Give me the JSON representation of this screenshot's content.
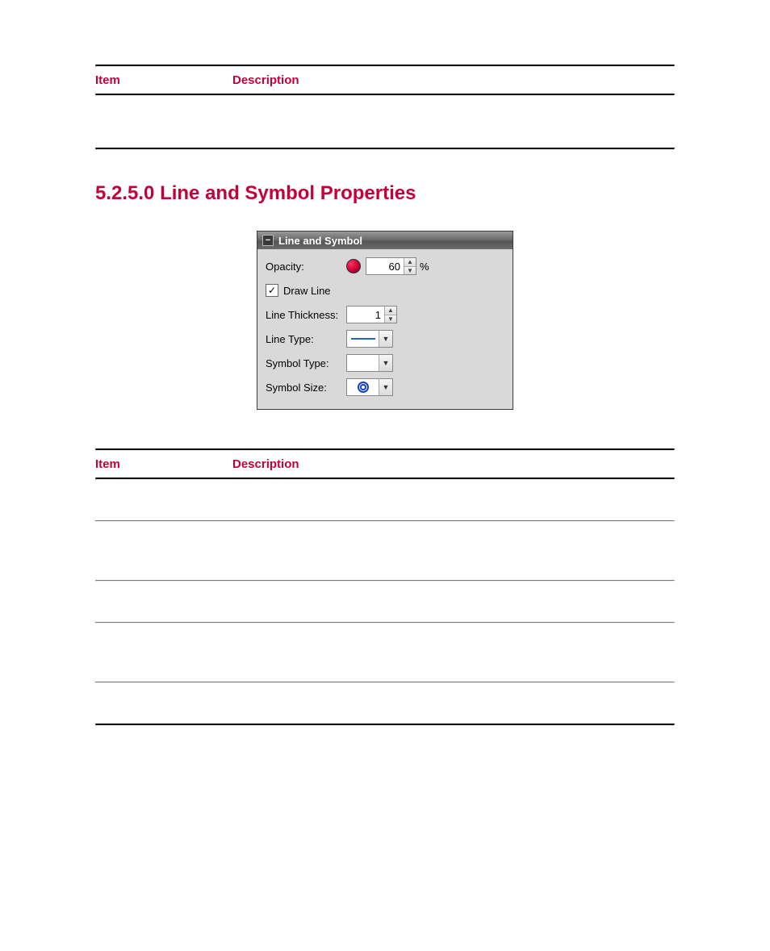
{
  "table1": {
    "header_item": "Item",
    "header_desc": "Description"
  },
  "section": {
    "title": "5.2.5.0 Line and Symbol Properties"
  },
  "panel": {
    "title": "Line and Symbol",
    "opacity_label": "Opacity:",
    "opacity_value": "60",
    "opacity_unit": "%",
    "drawline_label": "Draw Line",
    "drawline_checked": true,
    "thickness_label": "Line Thickness:",
    "thickness_value": "1",
    "linetype_label": "Line Type:",
    "symboltype_label": "Symbol Type:",
    "symbolsize_label": "Symbol Size:"
  },
  "table2": {
    "header_item": "Item",
    "header_desc": "Description"
  }
}
